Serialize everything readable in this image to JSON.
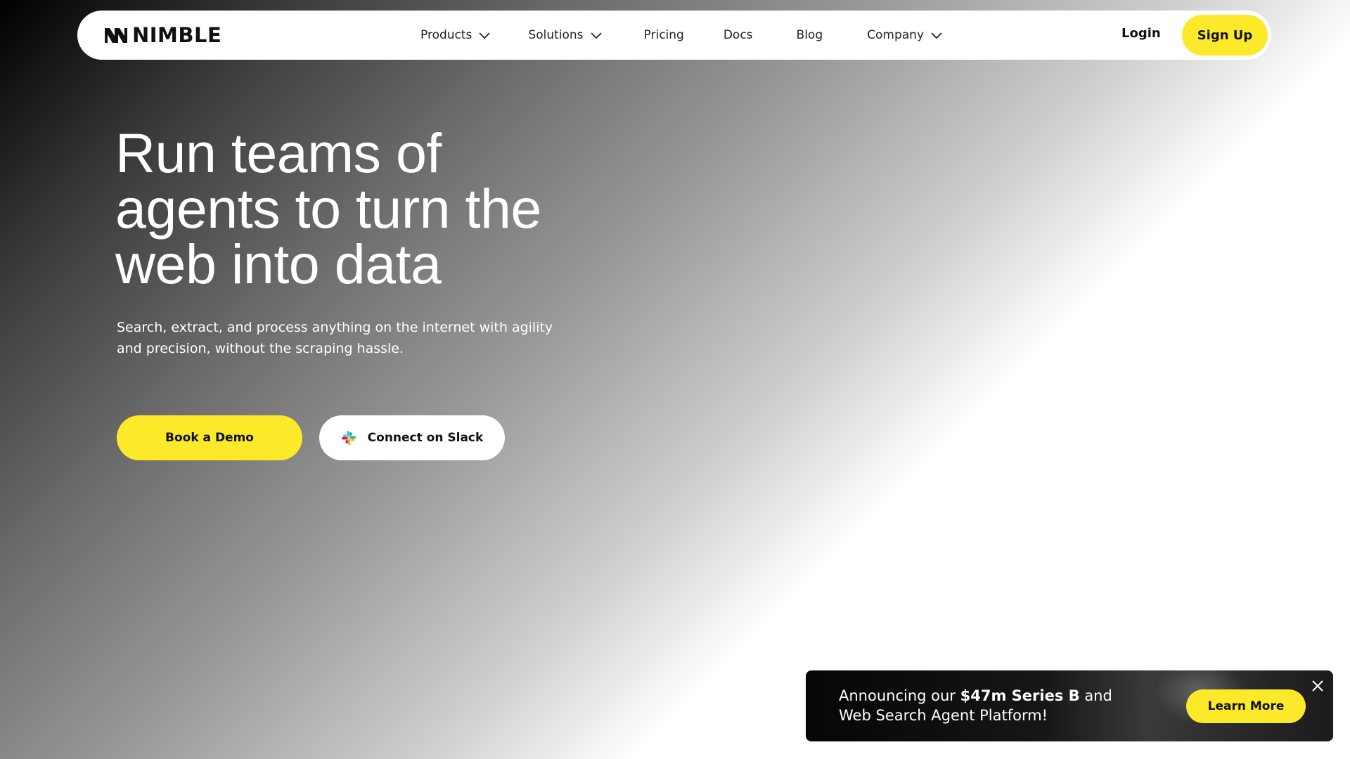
{
  "brand": {
    "name": "NIMBLE",
    "accent_color": "#fbe92a",
    "logo_icon": "nimble-logo-mark"
  },
  "nav": {
    "items": [
      {
        "label": "Products",
        "has_dropdown": true
      },
      {
        "label": "Solutions",
        "has_dropdown": true
      },
      {
        "label": "Pricing",
        "has_dropdown": false
      },
      {
        "label": "Docs",
        "has_dropdown": false
      },
      {
        "label": "Blog",
        "has_dropdown": false
      },
      {
        "label": "Company",
        "has_dropdown": true
      }
    ],
    "login_label": "Login",
    "signup_label": "Sign Up"
  },
  "hero": {
    "title_line1": "Run teams of",
    "title_line2": "agents to turn the",
    "title_line3": "web into data",
    "subtitle": "Search, extract, and process anything on the internet with agility and precision, without the scraping hassle.",
    "primary_cta": "Book a Demo",
    "secondary_cta": "Connect on Slack",
    "secondary_cta_icon": "slack-icon"
  },
  "banner": {
    "text_prefix": "Announcing our ",
    "text_bold": "$47m Series B",
    "text_suffix": " and Web Search Agent Platform!",
    "cta": "Learn More",
    "close_icon": "close-icon"
  }
}
